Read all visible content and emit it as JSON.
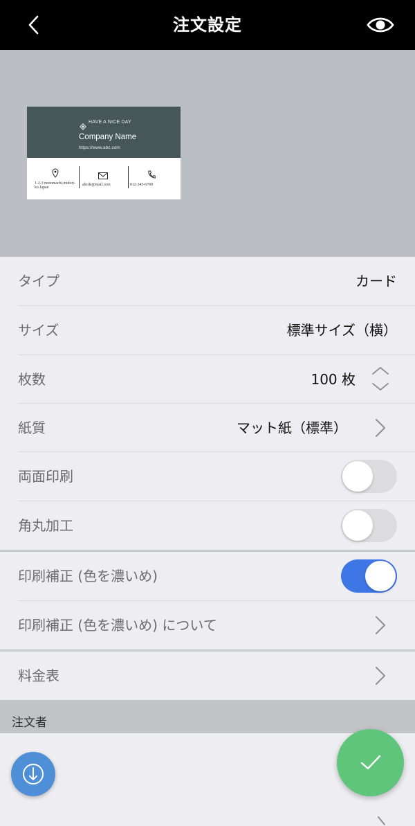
{
  "header": {
    "title": "注文設定",
    "back_icon": "chevron-left-icon",
    "preview_icon": "eye-icon"
  },
  "card_preview": {
    "tagline": "HAVE A NICE DAY",
    "company": "Company Name",
    "url": "https://www.abc.com",
    "address_line1": "1-2-3 motomachi,midori-",
    "address_line2": "ku Japan",
    "email": "abcde@mail.com",
    "phone": "012-345-6789",
    "top_color": "#46575a"
  },
  "settings": {
    "type": {
      "label": "タイプ",
      "value": "カード"
    },
    "size": {
      "label": "サイズ",
      "value": "標準サイズ（横）"
    },
    "quantity": {
      "label": "枚数",
      "value": "100 枚"
    },
    "paper": {
      "label": "紙質",
      "value": "マット紙（標準）"
    },
    "duplex": {
      "label": "両面印刷",
      "on": false
    },
    "rounded": {
      "label": "角丸加工",
      "on": false
    },
    "color_correction": {
      "label": "印刷補正 (色を濃いめ)",
      "on": true
    },
    "color_correction_about": {
      "label": "印刷補正 (色を濃いめ) について"
    },
    "price_table": {
      "label": "料金表"
    }
  },
  "orderer_section": {
    "label": "注文者"
  },
  "colors": {
    "header_bg": "#000000",
    "toggle_on": "#3e76e6",
    "confirm_fab": "#5ec57a",
    "info_fab": "#4f8fd8"
  }
}
